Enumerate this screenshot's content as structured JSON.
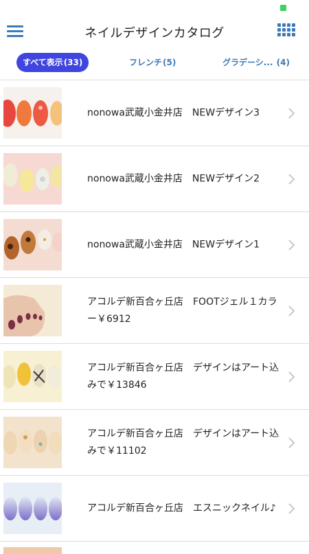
{
  "header": {
    "title": "ネイルデザインカタログ",
    "menu_icon": "hamburger-menu-icon",
    "grid_icon": "grid-view-icon",
    "accent": "#3d79b6"
  },
  "tabs": [
    {
      "label": "すべて表示",
      "count": "(33)",
      "active": true
    },
    {
      "label": "フレンチ",
      "count": "(5)",
      "active": false
    },
    {
      "label": "グラデーシ...",
      "count": "(4)",
      "active": false
    }
  ],
  "items": [
    {
      "text": "nonowa武蔵小金井店　NEWデザイン3"
    },
    {
      "text": "nonowa武蔵小金井店　NEWデザイン2"
    },
    {
      "text": "nonowa武蔵小金井店　NEWデザイン1"
    },
    {
      "text": "アコルデ新百合ヶ丘店　FOOTジェル１カラー￥6912"
    },
    {
      "text": "アコルデ新百合ヶ丘店　デザインはアート込みで￥13846"
    },
    {
      "text": "アコルデ新百合ヶ丘店　デザインはアート込みで￥11102"
    },
    {
      "text": "アコルデ新百合ヶ丘店　エスニックネイル♪"
    }
  ],
  "colors": {
    "active_tab_bg": "#3f45de",
    "divider": "#dcdcdc",
    "chevron": "#c7c7cc",
    "status_dot": "#3cd35f"
  }
}
